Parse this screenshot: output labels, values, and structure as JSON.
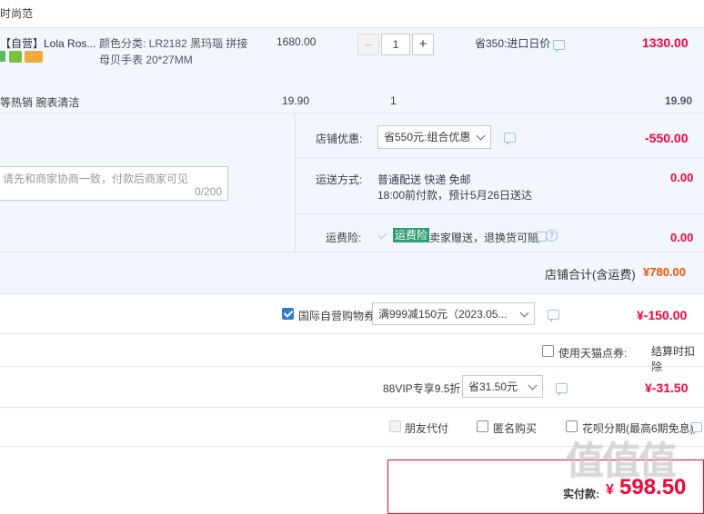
{
  "header": {
    "text": "时尚范"
  },
  "item1": {
    "title": "【自营】Lola Ros...",
    "spec_line1": "颜色分类:  LR2182 黑玛瑙 拼接",
    "spec_line2": "母贝手表 20*27MM",
    "unit_price": "1680.00",
    "qty_minus": "−",
    "quantity": "1",
    "qty_plus": "+",
    "promo": "省350:进口日价",
    "subtotal": "1330.00"
  },
  "item2": {
    "title": "等热销 腕表清洁",
    "unit_price": "19.90",
    "quantity": "1",
    "subtotal": "19.90"
  },
  "store": {
    "discount_label": "店铺优惠:",
    "discount_option": "省550元:组合优惠",
    "discount_amount": "-550.00",
    "note_placeholder": "请先和商家协商一致，付款后商家可见",
    "note_counter": "0/200",
    "shipping_label": "运送方式:",
    "shipping_line1": "普通配送 快递 免邮",
    "shipping_line2": "18:00前付款，预计5月26日送达",
    "shipping_amount": "0.00",
    "insurance_label": "运费险:",
    "insurance_badge": "运费险",
    "insurance_text": "卖家赠送，退换货可赔",
    "insurance_amount": "0.00",
    "total_label": "店铺合计(含运费)",
    "total_amount": "¥780.00"
  },
  "coupon": {
    "label": "国际自营购物券",
    "option": "满999减150元（2023.05...",
    "amount": "¥-150.00"
  },
  "tmall_points": {
    "label": "使用天猫点券:",
    "note": "结算时扣除"
  },
  "vip": {
    "label": "88VIP专享9.5折",
    "option": "省31.50元",
    "amount": "¥-31.50"
  },
  "options": {
    "friend_pay": "朋友代付",
    "anonymous": "匿名购买",
    "huabei": "花呗分期(最高6期免息)"
  },
  "payment": {
    "label": "实付款:",
    "currency": "¥",
    "amount": "598.50"
  },
  "watermark": {
    "text": "值值值"
  },
  "colors": {
    "price_red": "#ff0036",
    "accent_blue": "#2f7bd8",
    "panel_bg": "#f2f7ff"
  }
}
